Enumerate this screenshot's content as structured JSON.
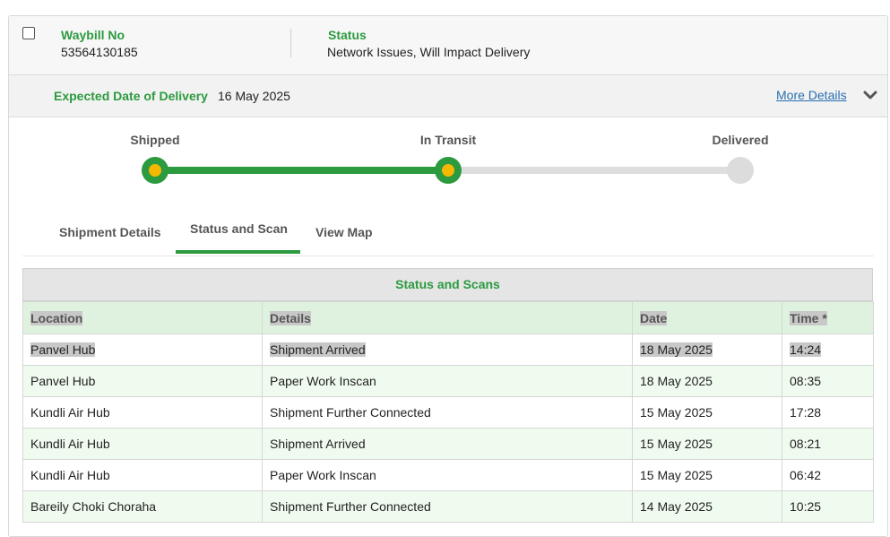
{
  "shipment": {
    "waybill_label": "Waybill No",
    "waybill_no": "53564130185",
    "status_label": "Status",
    "status": "Network Issues, Will Impact Delivery",
    "edd_label": "Expected Date of Delivery",
    "edd": "16 May 2025",
    "more_details": "More Details"
  },
  "tracker": {
    "steps": [
      {
        "label": "Shipped",
        "state": "done"
      },
      {
        "label": "In Transit",
        "state": "done"
      },
      {
        "label": "Delivered",
        "state": "pending"
      }
    ],
    "colors": {
      "done": "#2c9a3f",
      "dot": "#f5b800",
      "pending": "#dcdcdc"
    }
  },
  "tabs": [
    {
      "label": "Shipment Details",
      "active": false
    },
    {
      "label": "Status and Scan",
      "active": true
    },
    {
      "label": "View Map",
      "active": false
    }
  ],
  "scans": {
    "title": "Status and Scans",
    "headers": [
      "Location",
      "Details",
      "Date",
      "Time *"
    ],
    "rows": [
      [
        "Panvel Hub",
        "Shipment Arrived",
        "18 May 2025",
        "14:24"
      ],
      [
        "Panvel Hub",
        "Paper Work Inscan",
        "18 May 2025",
        "08:35"
      ],
      [
        "Kundli Air Hub",
        "Shipment Further Connected",
        "15 May 2025",
        "17:28"
      ],
      [
        "Kundli Air Hub",
        "Shipment Arrived",
        "15 May 2025",
        "08:21"
      ],
      [
        "Kundli Air Hub",
        "Paper Work Inscan",
        "15 May 2025",
        "06:42"
      ],
      [
        "Bareily Choki Choraha",
        "Shipment Further Connected",
        "14 May 2025",
        "10:25"
      ]
    ]
  },
  "icons": {
    "expand": "chevron-down-icon",
    "select": "checkbox"
  }
}
